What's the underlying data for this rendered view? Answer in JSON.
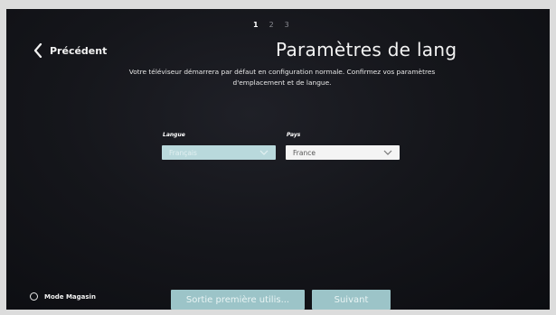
{
  "steps": [
    "1",
    "2",
    "3"
  ],
  "header": {
    "back_label": "Précédent",
    "title": "Paramètres de lang",
    "subtitle": "Votre téléviseur démarrera par défaut en configuration normale. Confirmez vos paramètres d'emplacement et de langue."
  },
  "form": {
    "language": {
      "label": "Langue",
      "value": "Français"
    },
    "country": {
      "label": "Pays",
      "value": "France"
    }
  },
  "footer": {
    "store_mode_label": "Mode Magasin",
    "exit_button_label": "Sortie première utilis...",
    "next_button_label": "Suivant"
  },
  "colors": {
    "background": "#15161b",
    "accent": "#9cc4c8",
    "text": "#f3f3f3"
  },
  "icons": {
    "back": "chevron-left-icon",
    "dropdown": "chevron-down-icon",
    "store_mode": "radio-unchecked-icon"
  }
}
